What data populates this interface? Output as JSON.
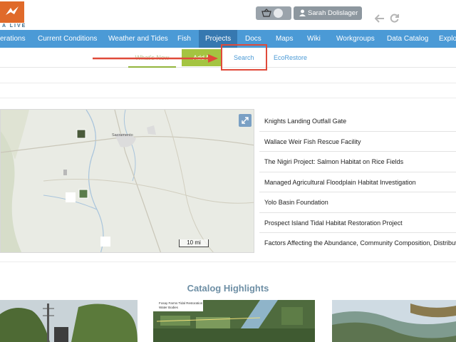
{
  "header": {
    "logo_text": "A LIVE",
    "user_label": "Sarah Dolislager"
  },
  "nav": {
    "items": [
      {
        "label": "erations"
      },
      {
        "label": "Current Conditions"
      },
      {
        "label": "Weather and Tides"
      },
      {
        "label": "Fish"
      },
      {
        "label": "Projects"
      },
      {
        "label": "Docs"
      },
      {
        "label": "Maps"
      },
      {
        "label": "Wiki"
      },
      {
        "label": "Workgroups"
      },
      {
        "label": "Data Catalog"
      },
      {
        "label": "Explor"
      }
    ]
  },
  "subnav": {
    "whats_new": "What's New",
    "add": "Add N",
    "search": "Search",
    "ecorestore": "EcoRestore"
  },
  "map": {
    "scale_label": "10 mi",
    "labels": [
      "Sacramento"
    ]
  },
  "projects": [
    "Knights Landing Outfall Gate",
    "Wallace Weir Fish Rescue Facility",
    "The Nigiri Project: Salmon Habitat on Rice Fields",
    "Managed Agricultural Floodplain Habitat Investigation",
    "Yolo Basin Foundation",
    "Prospect Island Tidal Habitat Restoration Project",
    "Factors Affecting the Abundance, Community Composition, Distribut"
  ],
  "catalog": {
    "title": "Catalog Highlights",
    "thumb2_caption_1": "Fosay Farms Tidal Restoration",
    "thumb2_caption_2": "Water Bodies"
  },
  "colors": {
    "nav_bg": "#4b9ad6",
    "nav_active": "#3678b0",
    "highlight_red": "#e04a3a",
    "add_green": "#a4c441",
    "logo_orange": "#e06a2a"
  }
}
